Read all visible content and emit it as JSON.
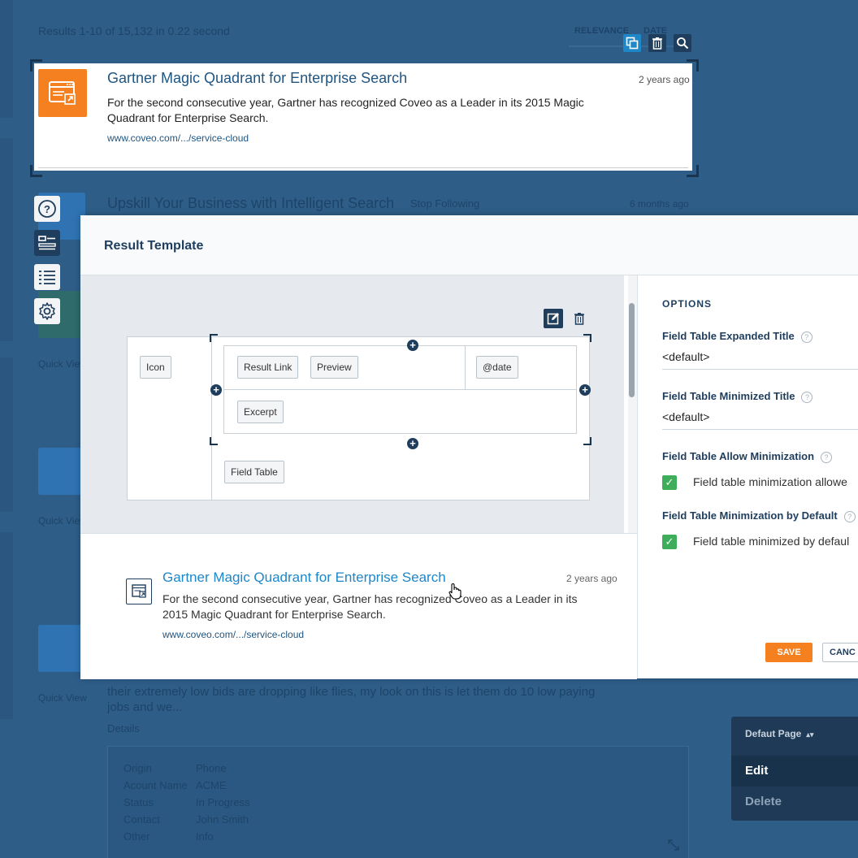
{
  "background": {
    "results_summary": "Results 1-10 of 15,132 in 0.22 second",
    "sort_relevance": "RELEVANCE",
    "sort_date": "DATE",
    "result2_title": "Upskill Your Business with Intelligent Search",
    "result2_follow": "Stop Following",
    "result2_time": "6 months ago",
    "quick_view": "Quick View",
    "excerpt_line1": "their extremely low bids are dropping like flies, my look on this is let them do 10 low paying",
    "excerpt_line2": "jobs and we...",
    "details_label": "Details",
    "details": [
      {
        "key": "Origin",
        "value": "Phone"
      },
      {
        "key": "Acount Name",
        "value": "ACME"
      },
      {
        "key": "Status",
        "value": "In Progress"
      },
      {
        "key": "Contact",
        "value": "John Smith"
      },
      {
        "key": "Other",
        "value": "Info"
      }
    ]
  },
  "highlighted_result": {
    "title": "Gartner Magic Quadrant for Enterprise Search",
    "time": "2 years ago",
    "excerpt_line1": "For the second consecutive year, Gartner has recognized Coveo as a Leader in its 2015 Magic",
    "excerpt_line2": "Quadrant for Enterprise Search.",
    "url": "www.coveo.com/.../service-cloud",
    "icon": "document-link-icon",
    "accent": "#f58020"
  },
  "toolbar_icons": [
    "duplicate-icon",
    "trash-icon",
    "search-icon"
  ],
  "side_toolbar": [
    "help-icon",
    "layout-icon",
    "list-icon",
    "gear-icon"
  ],
  "modal": {
    "title": "Result Template",
    "canvas": {
      "icon_chip": "Icon",
      "result_link_chip": "Result Link",
      "preview_chip": "Preview",
      "date_chip": "@date",
      "excerpt_chip": "Excerpt",
      "field_table_chip": "Field Table"
    },
    "preview": {
      "title": "Gartner Magic Quadrant for Enterprise Search",
      "time": "2 years ago",
      "excerpt_line1": "For the second consecutive year, Gartner has recognized Coveo as a Leader in its",
      "excerpt_line2": "2015 Magic Quadrant for Enterprise Search.",
      "url": "www.coveo.com/.../service-cloud"
    },
    "options": {
      "heading": "OPTIONS",
      "expanded_title_label": "Field Table Expanded Title",
      "expanded_title_value": "<default>",
      "minimized_title_label": "Field Table Minimized Title",
      "minimized_title_value": "<default>",
      "allow_min_label": "Field Table Allow Minimization",
      "allow_min_checkbox": "Field table minimization allowe",
      "min_default_label": "Field Table Minimization by Default",
      "min_default_checkbox": "Field table minimized by defaul",
      "save": "SAVE",
      "cancel": "CANC"
    }
  },
  "page_menu": {
    "selector": "Defaut Page",
    "edit": "Edit",
    "delete": "Delete"
  },
  "colors": {
    "primary": "#1f3d5c",
    "link": "#1e87c8",
    "save": "#f58020",
    "checkbox": "#3fae5a"
  }
}
